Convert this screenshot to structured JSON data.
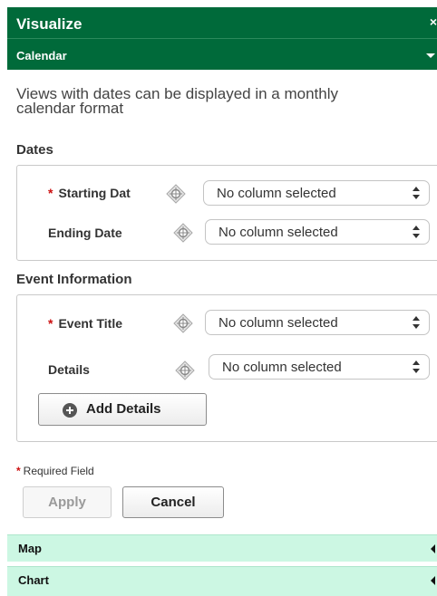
{
  "panel": {
    "title": "Visualize",
    "close_glyph": "×",
    "section": "Calendar",
    "description": "Views with dates can be displayed in a monthly calendar format"
  },
  "dates": {
    "heading": "Dates",
    "starting_label": "Starting Dat",
    "starting_value": "No column selected",
    "ending_label": "Ending Date",
    "ending_value": "No column selected"
  },
  "event": {
    "heading": "Event Information",
    "title_label": "Event Title",
    "title_value": "No column selected",
    "details_label": "Details",
    "details_value": "No column selected",
    "add_details_label": "Add Details"
  },
  "footer": {
    "required_marker": "*",
    "required_note": "Required Field",
    "apply_label": "Apply",
    "cancel_label": "Cancel"
  },
  "accordions": {
    "map_label": "Map",
    "chart_label": "Chart"
  },
  "icons": {
    "crosshair": "crosshair-icon",
    "add": "plus-circle-icon",
    "select_arrows": "updown-arrows-icon",
    "collapse_caret": "caret-down-icon",
    "expand_caret": "caret-left-icon"
  },
  "colors": {
    "header_bg": "#006a3a",
    "accordion_bg": "#ccf7e3",
    "required": "#cc1010"
  }
}
